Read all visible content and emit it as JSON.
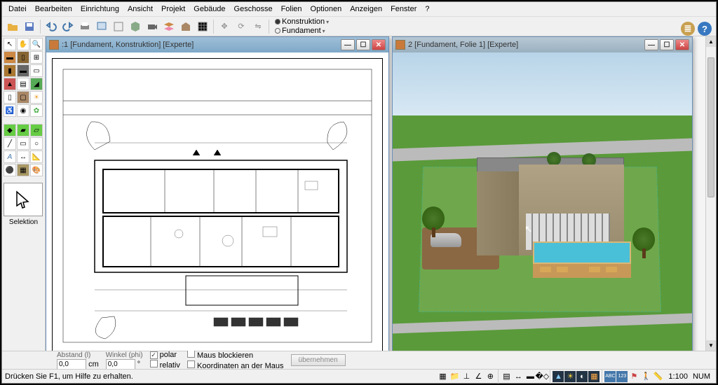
{
  "menu": [
    "Datei",
    "Bearbeiten",
    "Einrichtung",
    "Ansicht",
    "Projekt",
    "Gebäude",
    "Geschosse",
    "Folien",
    "Optionen",
    "Anzeigen",
    "Fenster",
    "?"
  ],
  "layers": {
    "a": "Konstruktion",
    "b": "Fundament"
  },
  "left_label": "Selektion",
  "windows": {
    "left_title": ":1 [Fundament, Konstruktion] [Experte]",
    "right_title": "2 [Fundament, Folie 1] [Experte]"
  },
  "bottom": {
    "abstand_label": "Abstand (l)",
    "abstand_val": "0,0",
    "abstand_unit": "cm",
    "winkel_label": "Winkel (phi)",
    "winkel_val": "0,0",
    "winkel_unit": "°",
    "polar": "polar",
    "relativ": "relativ",
    "maus": "Maus blockieren",
    "koord": "Koordinaten an der Maus",
    "uebernehmen": "übernehmen"
  },
  "status": {
    "help": "Drücken Sie F1, um Hilfe zu erhalten.",
    "scale": "1:100",
    "num": "NUM"
  }
}
